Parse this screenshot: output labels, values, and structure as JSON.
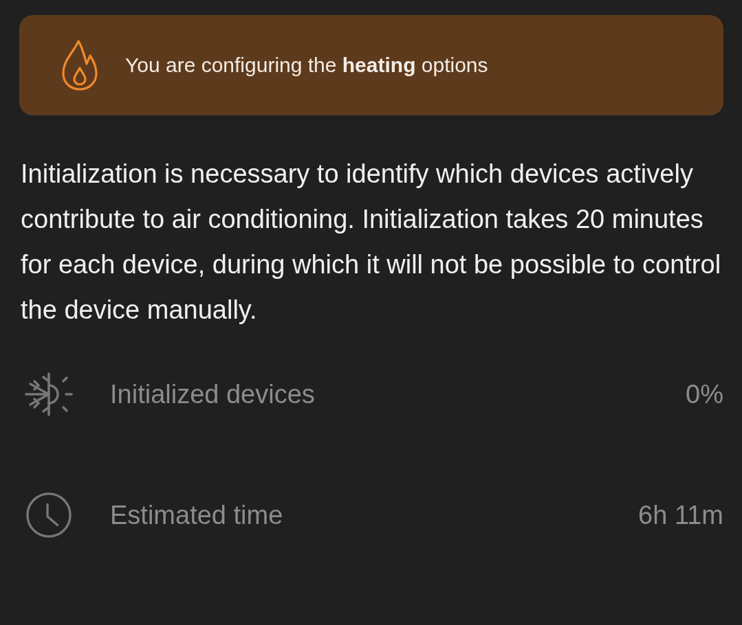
{
  "banner": {
    "text": "You are configuring the **heating** options"
  },
  "description": "Initialization is necessary to identify which devices actively contribute to air conditioning. Initialization takes 20 minutes for each device, during which it will not be possible to control the device manually.",
  "stats": [
    {
      "kind": "climate",
      "label": "Initialized devices",
      "value": "0%"
    },
    {
      "kind": "clock",
      "label": "Estimated time",
      "value": "6h 11m"
    }
  ]
}
